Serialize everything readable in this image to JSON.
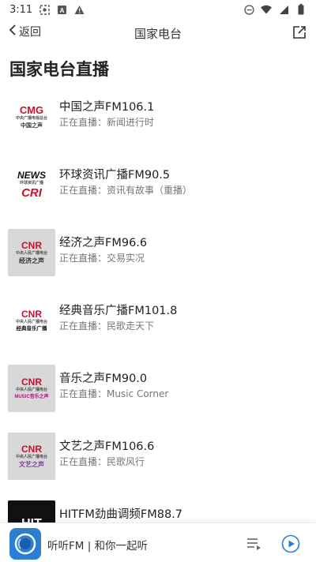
{
  "status_bar": {
    "time": "3:11",
    "left_icons": [
      "screenshot-icon",
      "app-a-icon",
      "warning-icon"
    ],
    "right_icons": [
      "do-not-disturb-icon",
      "wifi-icon",
      "signal-icon",
      "battery-icon"
    ]
  },
  "nav": {
    "back_label": "返回",
    "title": "国家电台",
    "share_icon": "share-icon"
  },
  "section_title": "国家电台直播",
  "stations": [
    {
      "name": "中国之声FM106.1",
      "status": "正在直播：新闻进行时",
      "logo": {
        "style": "white",
        "top": "CMG",
        "sub": "中央广播电视总台",
        "bottom": "中国之声"
      }
    },
    {
      "name": "环球资讯广播FM90.5",
      "status": "正在直播：资讯有故事（重播）",
      "logo": {
        "style": "white",
        "top": "NEWS",
        "sub": "环球资讯广播",
        "bottom": "CRI"
      }
    },
    {
      "name": "经济之声FM96.6",
      "status": "正在直播：交易实况",
      "logo": {
        "style": "gray",
        "top": "CNR",
        "sub": "中央人民广播电台",
        "bottom": "经济之声"
      }
    },
    {
      "name": "经典音乐广播FM101.8",
      "status": "正在直播：民歌走天下",
      "logo": {
        "style": "white",
        "top": "CNR",
        "sub": "中央人民广播电台",
        "bottom": "经典音乐广播"
      }
    },
    {
      "name": "音乐之声FM90.0",
      "status": "正在直播：Music Corner",
      "logo": {
        "style": "gray",
        "top": "CNR",
        "sub": "中央人民广播电台",
        "bottom": "MUSIC音乐之声"
      }
    },
    {
      "name": "文艺之声FM106.6",
      "status": "正在直播：民歌风行",
      "logo": {
        "style": "gray",
        "top": "CNR",
        "sub": "中央人民广播电台",
        "bottom": "文艺之声"
      }
    },
    {
      "name": "HITFM劲曲调频FM88.7",
      "status": "",
      "logo": {
        "style": "black",
        "top": "HIT",
        "sub": "",
        "bottom": ""
      }
    }
  ],
  "player": {
    "title": "听听FM | 和你一起听",
    "playlist_icon": "playlist-icon",
    "play_icon": "play-icon"
  },
  "colors": {
    "brand_red": "#c8102e",
    "player_blue": "#2a7fd4"
  }
}
